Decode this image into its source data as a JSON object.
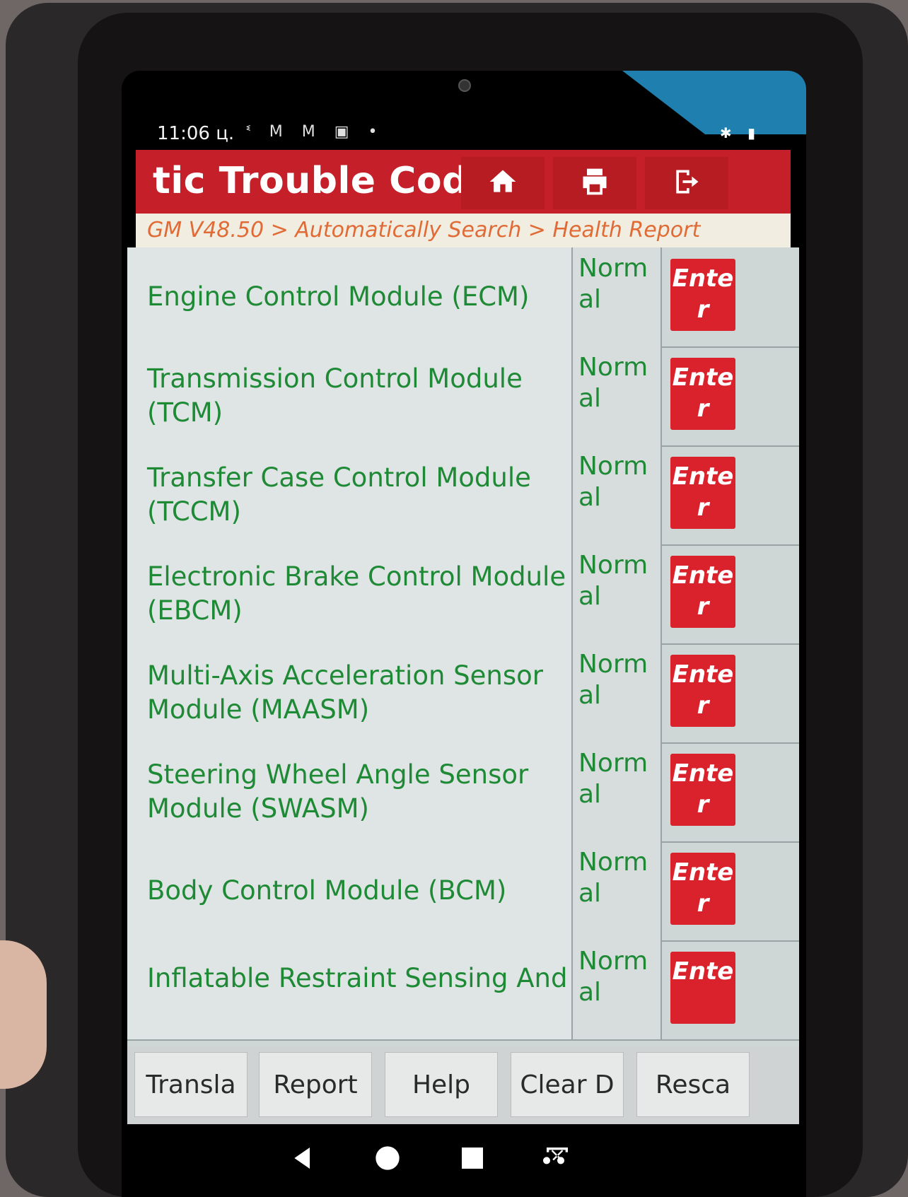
{
  "status_bar": {
    "time": "11:06 ц.",
    "notification_icons": "ᓫ M M ▣ •",
    "right_icons": "✱ ▮"
  },
  "header": {
    "title": "tic Trouble Code",
    "home_icon": "home-icon",
    "print_icon": "printer-icon",
    "exit_icon": "exit-icon"
  },
  "breadcrumb": "GM V48.50 > Automatically Search > Health Report",
  "modules": [
    {
      "name": "Engine Control Module (ECM)",
      "status": "Normal",
      "action": "Enter"
    },
    {
      "name": "Transmission Control Module (TCM)",
      "status": "Normal",
      "action": "Enter"
    },
    {
      "name": "Transfer Case Control Module (TCCM)",
      "status": "Normal",
      "action": "Enter"
    },
    {
      "name": "Electronic Brake Control Module (EBCM)",
      "status": "Normal",
      "action": "Enter"
    },
    {
      "name": "Multi-Axis Acceleration Sensor Module (MAASM)",
      "status": "Normal",
      "action": "Enter"
    },
    {
      "name": "Steering Wheel Angle Sensor Module (SWASM)",
      "status": "Normal",
      "action": "Enter"
    },
    {
      "name": "Body Control Module (BCM)",
      "status": "Normal",
      "action": "Enter"
    },
    {
      "name": "Inflatable Restraint Sensing And",
      "status": "Normal",
      "action": "Ente"
    }
  ],
  "toolbar": {
    "translate": "Transla",
    "report": "Report",
    "help": "Help",
    "clear": "Clear D",
    "rescan": "Resca"
  },
  "colors": {
    "title_bar": "#c5202a",
    "module_text": "#1e8a35",
    "enter_button": "#d9222b",
    "breadcrumb_text": "#e06b36"
  }
}
